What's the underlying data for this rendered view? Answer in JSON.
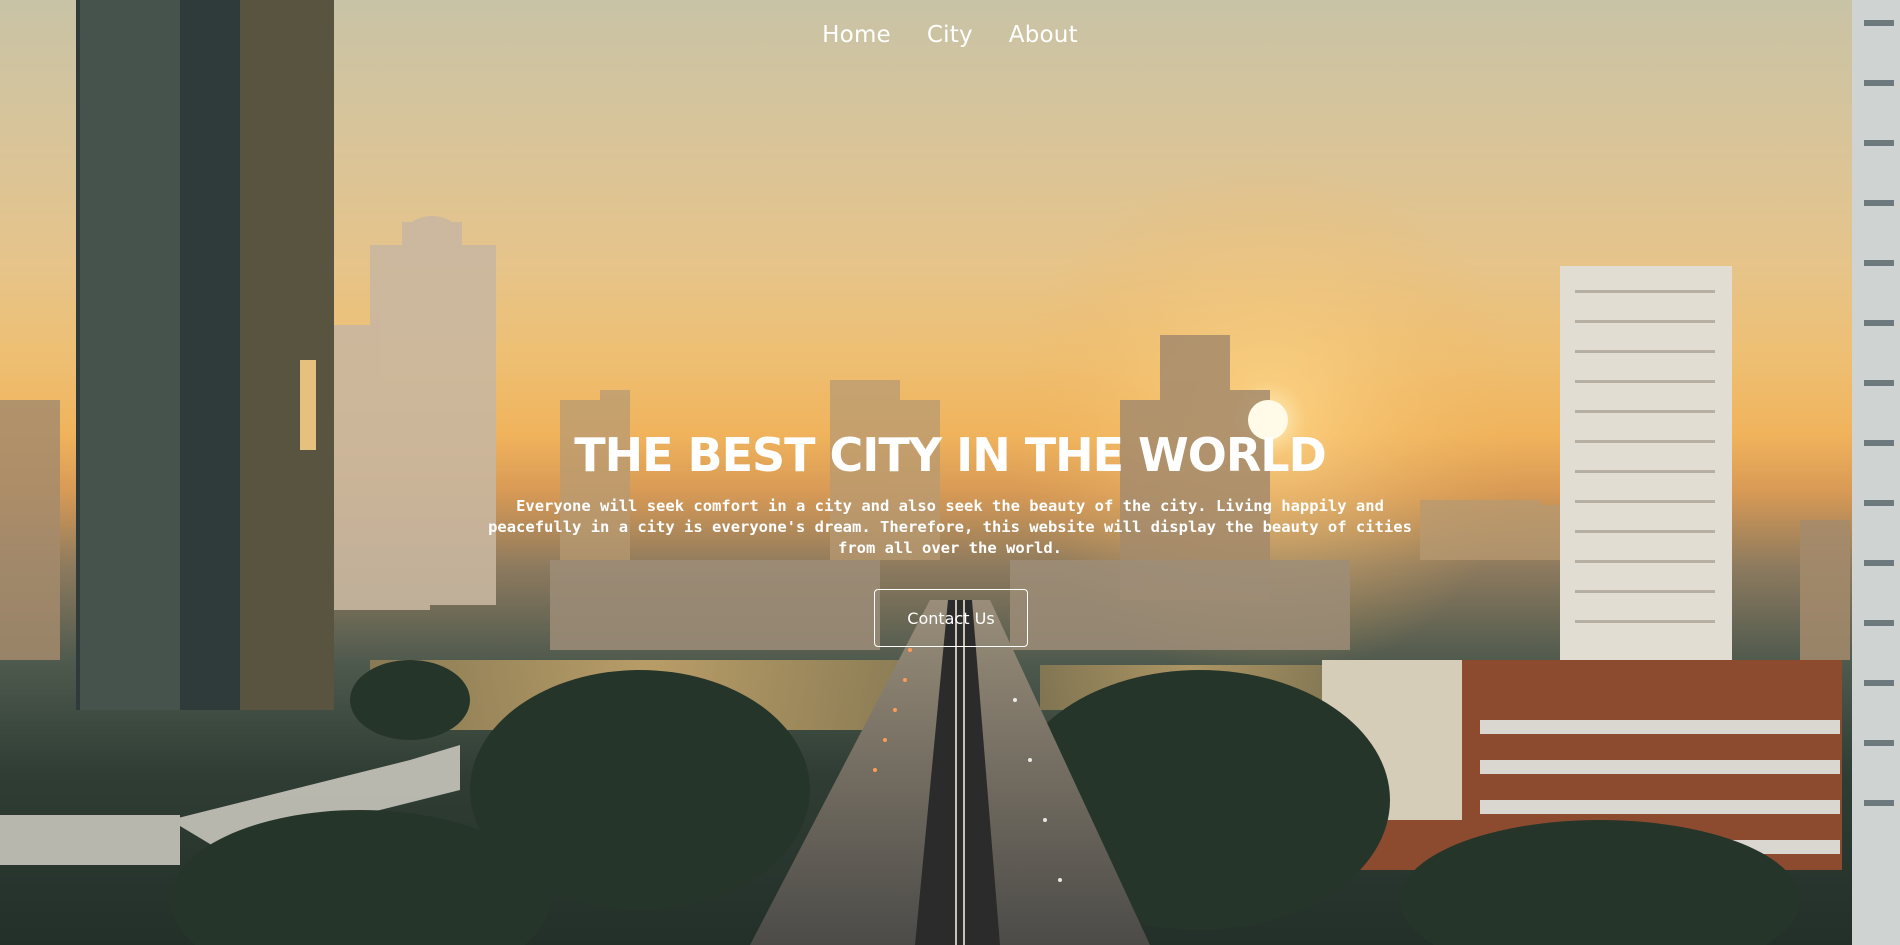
{
  "nav": {
    "items": [
      {
        "label": "Home"
      },
      {
        "label": "City"
      },
      {
        "label": "About"
      }
    ]
  },
  "hero": {
    "title": "THE BEST CITY IN THE WORLD",
    "description_lines": [
      "Everyone will seek comfort in a city and also seek the beauty of the city. Living happily and",
      "peacefully in a city is everyone's dream. Therefore, this website will display the beauty of cities",
      "from all over the world."
    ],
    "cta_label": "Contact Us"
  },
  "colors": {
    "text": "#ffffff",
    "sky_top": "#c8c3a6",
    "sunset": "#f0b35c",
    "ground": "#23302a"
  }
}
